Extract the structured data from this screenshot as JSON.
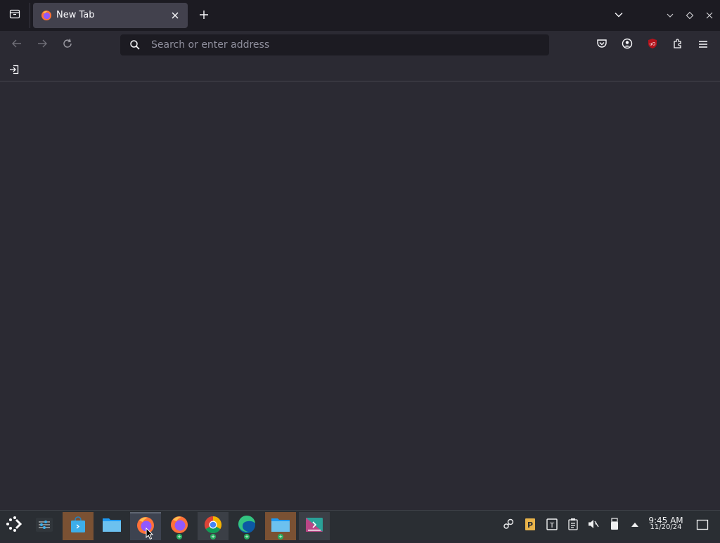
{
  "browser": {
    "tab": {
      "title": "New Tab",
      "close_label": "×"
    },
    "new_tab_label": "+",
    "urlbar": {
      "placeholder": "Search or enter address",
      "value": ""
    }
  },
  "taskbar": {
    "apps": [
      "Discover",
      "Dolphin",
      "Firefox",
      "Firefox",
      "Google Chrome",
      "Microsoft Edge",
      "Dolphin",
      "Plasma Task"
    ],
    "clock": {
      "time": "9:45 AM",
      "date": "11/20/24"
    }
  },
  "colors": {
    "toolbar": "#2b2a33",
    "tabstrip": "#1c1b22",
    "selected_tab": "#42414d",
    "urlbar": "#1c1b22",
    "taskbar": "#2a2e33",
    "ublock_red": "#b5121b"
  }
}
